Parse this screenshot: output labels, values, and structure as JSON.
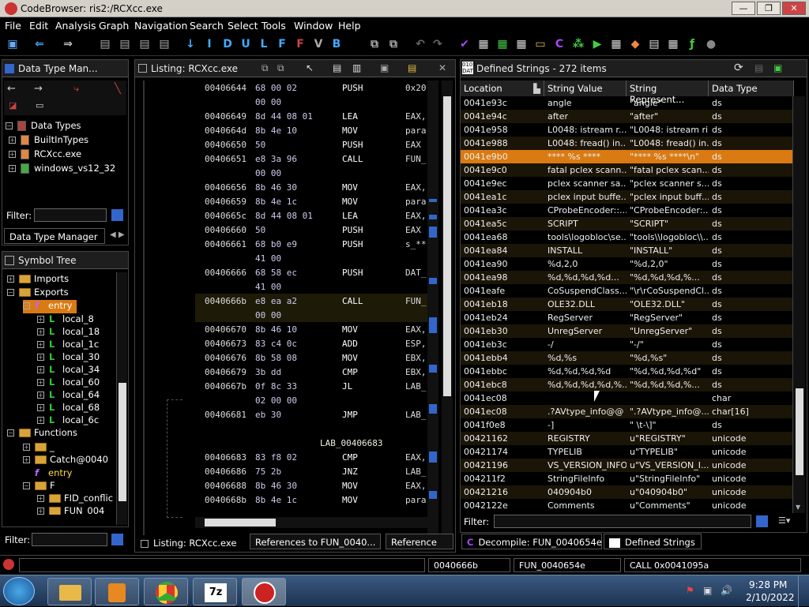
{
  "window": {
    "title": "CodeBrowser: ris2:/RCXcc.exe",
    "minimize": "—",
    "maximize": "❐",
    "close": "✕"
  },
  "menu": [
    "File",
    "Edit",
    "Analysis",
    "Graph",
    "Navigation",
    "Search",
    "Select",
    "Tools",
    "Window",
    "Help"
  ],
  "datatype_panel": {
    "title": "Data Type Man...",
    "root": "Data Types",
    "items": [
      "BuiltInTypes",
      "RCXcc.exe",
      "windows_vs12_32"
    ],
    "filter_label": "Filter:",
    "tab_label": "Data Type Manager"
  },
  "symbol_tree": {
    "title": "Symbol Tree",
    "imports": "Imports",
    "exports": "Exports",
    "entry": "entry",
    "locals": [
      "local_8",
      "local_18",
      "local_1c",
      "local_30",
      "local_34",
      "local_60",
      "local_64",
      "local_68",
      "local_6c"
    ],
    "functions": "Functions",
    "func_items": [
      "_",
      "Catch@0040",
      "entry",
      "F",
      "FID_conflic",
      "FUN_004"
    ],
    "filter_label": "Filter:"
  },
  "listing": {
    "title": "Listing:  RCXcc.exe",
    "rows": [
      {
        "addr": "00406644",
        "bytes": "68 00 02",
        "mn": "PUSH",
        "op": "0x20"
      },
      {
        "addr": "",
        "bytes": "00 00",
        "mn": "",
        "op": ""
      },
      {
        "addr": "00406649",
        "bytes": "8d 44 08 01",
        "mn": "LEA",
        "op": "EAX,"
      },
      {
        "addr": "0040664d",
        "bytes": "8b 4e 10",
        "mn": "MOV",
        "op": "para"
      },
      {
        "addr": "00406650",
        "bytes": "50",
        "mn": "PUSH",
        "op": "EAX"
      },
      {
        "addr": "00406651",
        "bytes": "e8 3a 96",
        "mn": "CALL",
        "op": "FUN_"
      },
      {
        "addr": "",
        "bytes": "00 00",
        "mn": "",
        "op": ""
      },
      {
        "addr": "00406656",
        "bytes": "8b 46 30",
        "mn": "MOV",
        "op": "EAX,"
      },
      {
        "addr": "00406659",
        "bytes": "8b 4e 1c",
        "mn": "MOV",
        "op": "para"
      },
      {
        "addr": "0040665c",
        "bytes": "8d 44 08 01",
        "mn": "LEA",
        "op": "EAX,"
      },
      {
        "addr": "00406660",
        "bytes": "50",
        "mn": "PUSH",
        "op": "EAX"
      },
      {
        "addr": "00406661",
        "bytes": "68 b0 e9",
        "mn": "PUSH",
        "op": "s_**"
      },
      {
        "addr": "",
        "bytes": "41 00",
        "mn": "",
        "op": ""
      },
      {
        "addr": "00406666",
        "bytes": "68 58 ec",
        "mn": "PUSH",
        "op": "DAT_"
      },
      {
        "addr": "",
        "bytes": "41 00",
        "mn": "",
        "op": ""
      },
      {
        "addr": "0040666b",
        "bytes": "e8 ea a2",
        "mn": "CALL",
        "op": "FUN_"
      },
      {
        "addr": "",
        "bytes": "00 00",
        "mn": "",
        "op": ""
      },
      {
        "addr": "00406670",
        "bytes": "8b 46 10",
        "mn": "MOV",
        "op": "EAX,"
      },
      {
        "addr": "00406673",
        "bytes": "83 c4 0c",
        "mn": "ADD",
        "op": "ESP,"
      },
      {
        "addr": "00406676",
        "bytes": "8b 58 08",
        "mn": "MOV",
        "op": "EBX,"
      },
      {
        "addr": "00406679",
        "bytes": "3b dd",
        "mn": "CMP",
        "op": "EBX,"
      },
      {
        "addr": "0040667b",
        "bytes": "0f 8c 33",
        "mn": "JL",
        "op": "LAB_"
      },
      {
        "addr": "",
        "bytes": "02 00 00",
        "mn": "",
        "op": ""
      },
      {
        "addr": "00406681",
        "bytes": "eb 30",
        "mn": "JMP",
        "op": "LAB_"
      },
      {
        "addr": "",
        "bytes": "",
        "mn": "",
        "op": ""
      },
      {
        "addr": "",
        "bytes": "",
        "mn": "LAB_00406683",
        "op": ""
      },
      {
        "addr": "00406683",
        "bytes": "83 f8 02",
        "mn": "CMP",
        "op": "EAX,"
      },
      {
        "addr": "00406686",
        "bytes": "75 2b",
        "mn": "JNZ",
        "op": "LAB_"
      },
      {
        "addr": "00406688",
        "bytes": "8b 46 30",
        "mn": "MOV",
        "op": "EAX,"
      },
      {
        "addr": "0040668b",
        "bytes": "8b 4e 1c",
        "mn": "MOV",
        "op": "para"
      }
    ],
    "bottom_tabs": [
      "Listing:  RCXcc.exe",
      "References to FUN_0040...",
      "Reference"
    ]
  },
  "defined_strings": {
    "title": "Defined Strings - 272 items",
    "columns": [
      "Location",
      "String Value",
      "String Represent...",
      "Data Type"
    ],
    "rows": [
      [
        "0041e93c",
        "angle",
        "\"angle\"",
        "ds"
      ],
      [
        "0041e94c",
        "after",
        "\"after\"",
        "ds"
      ],
      [
        "0041e958",
        "L0048: istream r...",
        "\"L0048: istream ri...",
        "ds"
      ],
      [
        "0041e988",
        "L0048: fread() in...",
        "\"L0048: fread() in...",
        "ds"
      ],
      [
        "0041e9b0",
        "**** %s ****",
        "\"**** %s ****\\n\"",
        "ds"
      ],
      [
        "0041e9c0",
        "fatal pclex scann...",
        "\"fatal pclex scan...",
        "ds"
      ],
      [
        "0041e9ec",
        "pclex scanner sa...",
        "\"pclex scanner s...",
        "ds"
      ],
      [
        "0041ea1c",
        "pclex input buffe...",
        "\"pclex input buff...",
        "ds"
      ],
      [
        "0041ea3c",
        "CProbeEncoder::...",
        "\"CProbeEncoder:...",
        "ds"
      ],
      [
        "0041ea5c",
        "SCRIPT",
        "\"SCRIPT\"",
        "ds"
      ],
      [
        "0041ea68",
        "tools\\logobloc\\se...",
        "\"tools\\\\logobloc\\\\...",
        "ds"
      ],
      [
        "0041ea84",
        "INSTALL",
        "\"INSTALL\"",
        "ds"
      ],
      [
        "0041ea90",
        "%d,2,0",
        "\"%d,2,0\"",
        "ds"
      ],
      [
        "0041ea98",
        "%d,%d,%d,%d...",
        "\"%d,%d,%d,%...",
        "ds"
      ],
      [
        "0041eafe",
        "CoSuspendClass...",
        "\"\\r\\rCoSuspendCl...",
        "ds"
      ],
      [
        "0041eb18",
        "OLE32.DLL",
        "\"OLE32.DLL\"",
        "ds"
      ],
      [
        "0041eb24",
        "RegServer",
        "\"RegServer\"",
        "ds"
      ],
      [
        "0041eb30",
        "UnregServer",
        "\"UnregServer\"",
        "ds"
      ],
      [
        "0041eb3c",
        "-/",
        "\"-/\"",
        "ds"
      ],
      [
        "0041ebb4",
        "%d,%s",
        "\"%d,%s\"",
        "ds"
      ],
      [
        "0041ebbc",
        "%d,%d,%d,%d",
        "\"%d,%d,%d,%d\"",
        "ds"
      ],
      [
        "0041ebc8",
        "%d,%d,%d,%d,%...",
        "\"%d,%d,%d,%...",
        "ds"
      ],
      [
        "0041ec08",
        "",
        "",
        "char"
      ],
      [
        "0041ec08",
        ".?AVtype_info@@",
        "\".?AVtype_info@...",
        "char[16]"
      ],
      [
        "0041f0e8",
        "-]",
        "\" \\t-\\]\"",
        "ds"
      ],
      [
        "00421162",
        "REGISTRY",
        "u\"REGISTRY\"",
        "unicode"
      ],
      [
        "00421174",
        "TYPELIB",
        "u\"TYPELIB\"",
        "unicode"
      ],
      [
        "00421196",
        "VS_VERSION_INFO",
        "u\"VS_VERSION_I...",
        "unicode"
      ],
      [
        "004211f2",
        "StringFileInfo",
        "u\"StringFileInfo\"",
        "unicode"
      ],
      [
        "00421216",
        "040904b0",
        "u\"040904b0\"",
        "unicode"
      ],
      [
        "0042122e",
        "Comments",
        "u\"Comments\"",
        "unicode"
      ]
    ],
    "selected_index": 4,
    "filter_label": "Filter:",
    "bottom_tabs": [
      "Decompile: FUN_0040654e",
      "Defined Strings"
    ]
  },
  "status": [
    "0040666b",
    "FUN_0040654e",
    "CALL 0x0041095a"
  ],
  "clock": {
    "time": "9:28 PM",
    "date": "2/10/2022"
  },
  "colors": {
    "selected_row": "#d97a12",
    "highlight_row": "#2a2510",
    "accent": "#3b7dd8"
  }
}
